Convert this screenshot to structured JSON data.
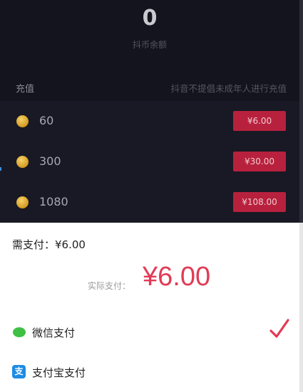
{
  "balance": {
    "value": "0",
    "label": "抖币余额"
  },
  "recharge": {
    "title": "充值",
    "notice": "抖音不提倡未成年人进行充值",
    "packages": [
      {
        "coins": "60",
        "price": "¥6.00"
      },
      {
        "coins": "300",
        "price": "¥30.00"
      },
      {
        "coins": "1080",
        "price": "¥108.00"
      }
    ]
  },
  "payment": {
    "need_pay": "需支付：¥6.00",
    "actual_label": "实际支付：",
    "actual_amount": "¥6.00",
    "methods": [
      {
        "label": "微信支付",
        "icon": "wechat-icon",
        "selected": true
      },
      {
        "label": "支付宝支付",
        "icon": "alipay-icon",
        "selected": false
      }
    ]
  },
  "colors": {
    "background_dark": "#13141d",
    "price_button": "#b8213d",
    "accent_red": "#e23a55",
    "wechat_green": "#3fc045",
    "alipay_blue": "#1e8ce3"
  }
}
